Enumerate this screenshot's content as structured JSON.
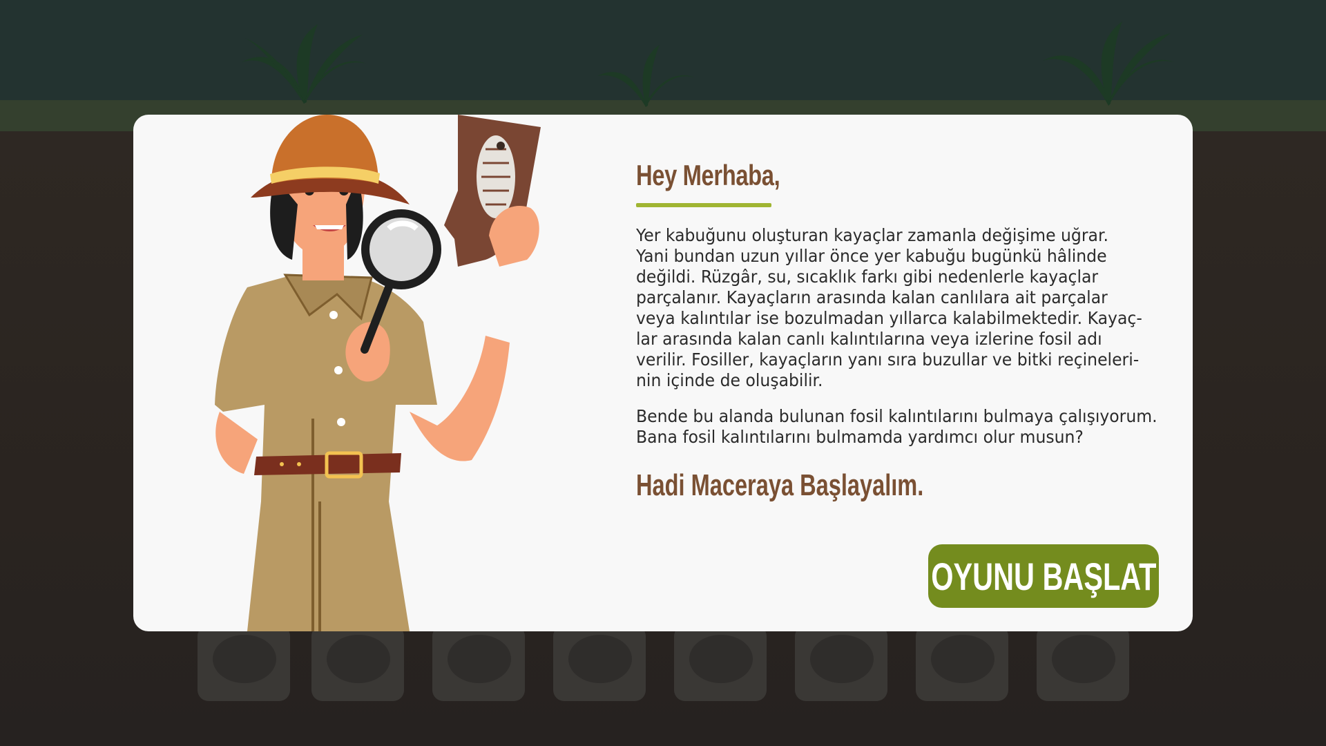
{
  "background": {
    "sky_color": "#233330",
    "grass_color": "#34402e",
    "soil_color": "#2a2522",
    "fossil_slots": [
      "leaf-fossil-icon",
      "ammonite-fossil-icon",
      "shell-fossil-icon",
      "skull-fossil-icon",
      "bone-fossil-icon",
      "fish-fossil-icon",
      "dragonfly-fossil-icon",
      "trilobite-fossil-icon"
    ]
  },
  "modal": {
    "greeting": "Hey Merhaba,",
    "paragraph1_lines": [
      "Yer kabuğunu oluşturan kayaçlar zamanla değişime uğrar.",
      "Yani bundan uzun yıllar önce yer kabuğu bugünkü hâlinde",
      "değildi. Rüzgâr, su, sıcaklık farkı gibi nedenlerle kayaçlar",
      "parçalanır. Kayaçların arasında kalan canlılara ait parçalar",
      "veya kalıntılar ise bozulmadan yıllarca kalabilmektedir. Kayaç-",
      "lar arasında kalan canlı kalıntılarına veya izlerine fosil adı",
      "verilir. Fosiller, kayaçların yanı sıra buzullar ve bitki reçineleri-",
      "nin içinde de oluşabilir."
    ],
    "paragraph2_lines": [
      "Bende bu alanda bulunan fosil kalıntılarını bulmaya çalışıyorum.",
      "Bana fosil kalıntılarını bulmamda yardımcı olur musun?"
    ],
    "call_to_action": "Hadi Maceraya Başlayalım.",
    "start_button_label": "OYUNU BAŞLAT",
    "accent_color": "#a0b532",
    "button_color": "#748c1e",
    "title_color": "#7a5033"
  }
}
